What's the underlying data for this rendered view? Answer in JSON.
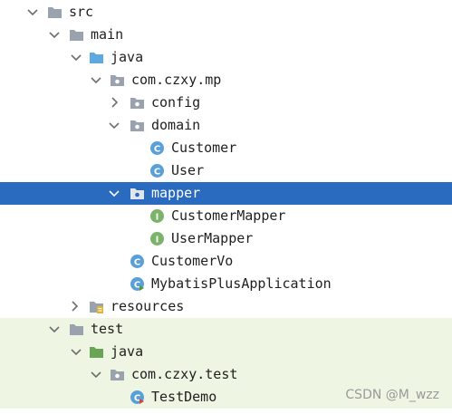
{
  "tree": {
    "items": [
      {
        "label": "src"
      },
      {
        "label": "main"
      },
      {
        "label": "java"
      },
      {
        "label": "com.czxy.mp"
      },
      {
        "label": "config"
      },
      {
        "label": "domain"
      },
      {
        "label": "Customer"
      },
      {
        "label": "User"
      },
      {
        "label": "mapper"
      },
      {
        "label": "CustomerMapper"
      },
      {
        "label": "UserMapper"
      },
      {
        "label": "CustomerVo"
      },
      {
        "label": "MybatisPlusApplication"
      },
      {
        "label": "resources"
      },
      {
        "label": "test"
      },
      {
        "label": "java"
      },
      {
        "label": "com.czxy.test"
      },
      {
        "label": "TestDemo"
      }
    ]
  },
  "watermark": "CSDN @M_wzz",
  "colors": {
    "selection": "#2a6bbf",
    "test_background": "#eef5e3",
    "class_icon": "#5aa0d8",
    "interface_icon": "#7bb369",
    "source_folder": "#5fa8e0",
    "test_folder": "#6aa556"
  }
}
